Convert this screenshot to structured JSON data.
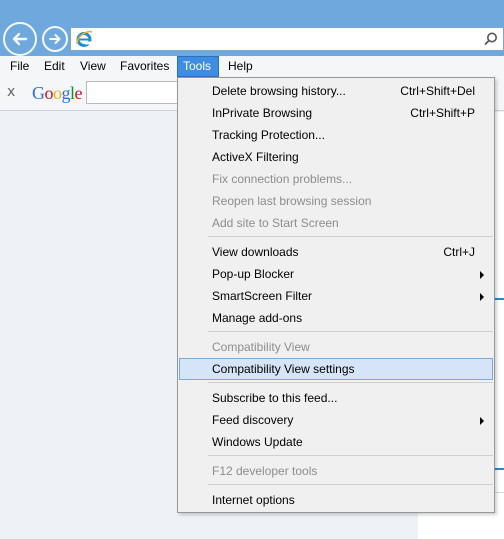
{
  "colors": {
    "nav_strip": "#6fa8dc",
    "menu_active": "#3e8de0",
    "dropdown_bg": "#f0f0f0",
    "highlight_bg": "#d5e4f6",
    "highlight_border": "#7ba9dc",
    "disabled_text": "#8d8d8d",
    "page_accent": "#2b88c4"
  },
  "menubar": {
    "items": [
      {
        "label": "File"
      },
      {
        "label": "Edit"
      },
      {
        "label": "View"
      },
      {
        "label": "Favorites"
      },
      {
        "label": "Tools",
        "active": true
      },
      {
        "label": "Help"
      }
    ]
  },
  "google_toolbar": {
    "close_glyph": "x",
    "logo_letters": [
      {
        "ch": "G",
        "color": "#3369e8"
      },
      {
        "ch": "o",
        "color": "#d50f25"
      },
      {
        "ch": "o",
        "color": "#eeb211"
      },
      {
        "ch": "g",
        "color": "#3369e8"
      },
      {
        "ch": "l",
        "color": "#009925"
      },
      {
        "ch": "e",
        "color": "#d50f25"
      }
    ]
  },
  "tools_menu": {
    "items": [
      {
        "label": "Delete browsing history...",
        "shortcut": "Ctrl+Shift+Del"
      },
      {
        "label": "InPrivate Browsing",
        "shortcut": "Ctrl+Shift+P"
      },
      {
        "label": "Tracking Protection...",
        "shortcut": ""
      },
      {
        "label": "ActiveX Filtering",
        "shortcut": ""
      },
      {
        "label": "Fix connection problems...",
        "shortcut": "",
        "disabled": true
      },
      {
        "label": "Reopen last browsing session",
        "shortcut": "",
        "disabled": true
      },
      {
        "label": "Add site to Start Screen",
        "shortcut": "",
        "disabled": true
      },
      {
        "label": "View downloads",
        "shortcut": "Ctrl+J"
      },
      {
        "label": "Pop-up Blocker",
        "shortcut": "",
        "submenu": true
      },
      {
        "label": "SmartScreen Filter",
        "shortcut": "",
        "submenu": true
      },
      {
        "label": "Manage add-ons",
        "shortcut": ""
      },
      {
        "label": "Compatibility View",
        "shortcut": "",
        "disabled": true
      },
      {
        "label": "Compatibility View settings",
        "shortcut": "",
        "highlighted": true
      },
      {
        "label": "Subscribe to this feed...",
        "shortcut": ""
      },
      {
        "label": "Feed discovery",
        "shortcut": "",
        "submenu": true
      },
      {
        "label": "Windows Update",
        "shortcut": ""
      },
      {
        "label": "F12 developer tools",
        "shortcut": "",
        "disabled": true
      },
      {
        "label": "Internet options",
        "shortcut": ""
      }
    ]
  }
}
